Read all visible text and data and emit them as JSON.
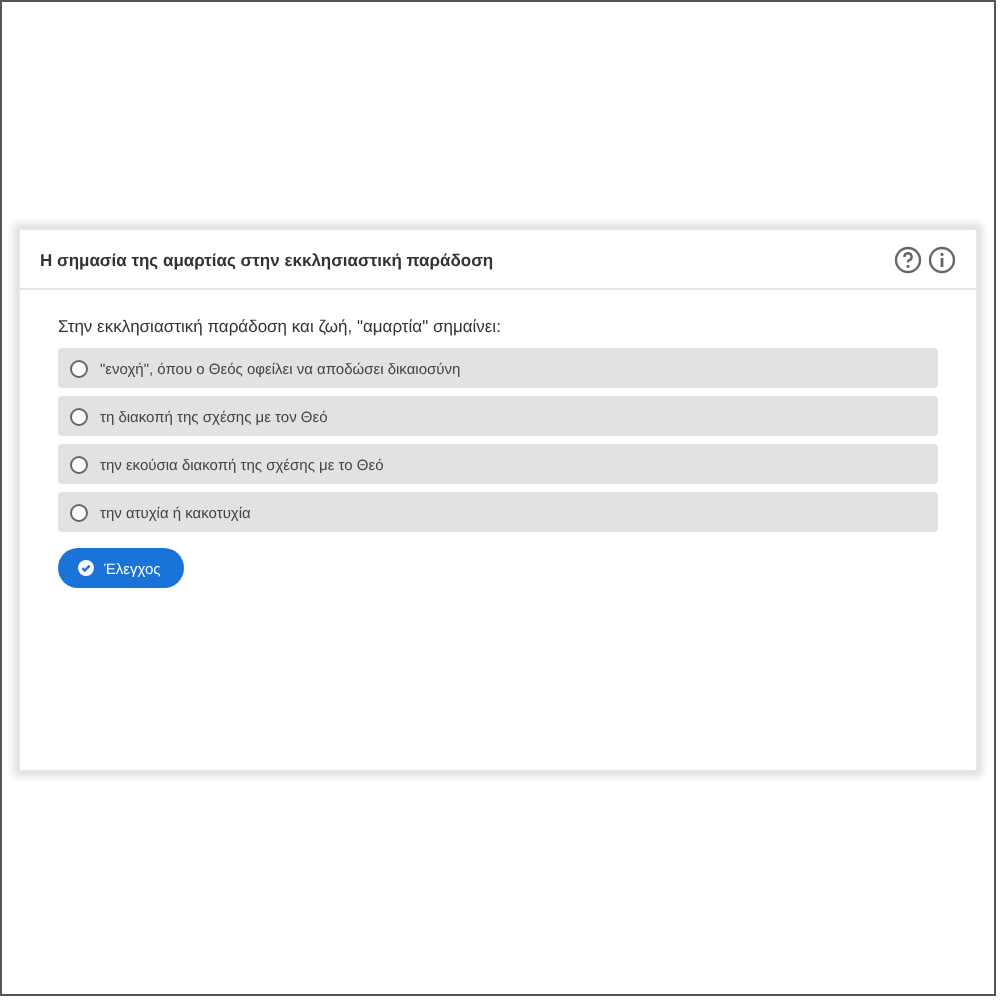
{
  "card": {
    "title": "Η σημασία της αμαρτίας στην εκκλησιαστική παράδοση"
  },
  "question": "Στην εκκλησιαστική παράδοση και ζωή, \"αμαρτία\" σημαίνει:",
  "options": [
    {
      "label": "\"ενοχή\", όπου ο Θεός οφείλει να αποδώσει δικαιοσύνη",
      "selected": false
    },
    {
      "label": "τη διακοπή της σχέσης με τον Θεό",
      "selected": false
    },
    {
      "label": "την εκούσια διακοπή της σχέσης με το Θεό",
      "selected": false
    },
    {
      "label": "την ατυχία ή κακοτυχία",
      "selected": false
    }
  ],
  "check_button": "Έλεγχος"
}
